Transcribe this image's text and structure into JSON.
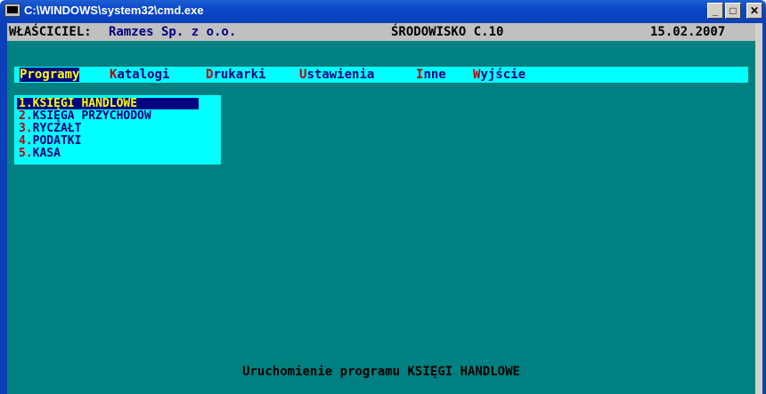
{
  "window": {
    "title": "C:\\WINDOWS\\system32\\cmd.exe",
    "buttons": {
      "minimize": "_",
      "maximize": "&#9633;",
      "close": "X"
    }
  },
  "header": {
    "owner_label": "WŁAŚCICIEL:",
    "owner_name": "Ramzes Sp. z o.o.",
    "environment": "ŚRODOWISKO C.10",
    "date": "15.02.2007"
  },
  "menu": [
    {
      "label": "Programy",
      "hot": "",
      "rest": ""
    },
    {
      "hot": "K",
      "rest": "atalogi"
    },
    {
      "hot": "D",
      "rest": "rukarki"
    },
    {
      "hot": "U",
      "rest": "stawienia"
    },
    {
      "hot": "I",
      "rest": "nne"
    },
    {
      "hot": "W",
      "rest": "yjście"
    }
  ],
  "programs": [
    {
      "num": "1.",
      "label": "KSIĘGI HANDLOWE"
    },
    {
      "num": "2.",
      "label": "KSIĘGA PRZYCHODÓW"
    },
    {
      "num": "3.",
      "label": "RYCZAŁT"
    },
    {
      "num": "4.",
      "label": "PODATKI"
    },
    {
      "num": "5.",
      "label": "KASA"
    }
  ],
  "status": "Uruchomienie programu KSIĘGI HANDLOWE"
}
